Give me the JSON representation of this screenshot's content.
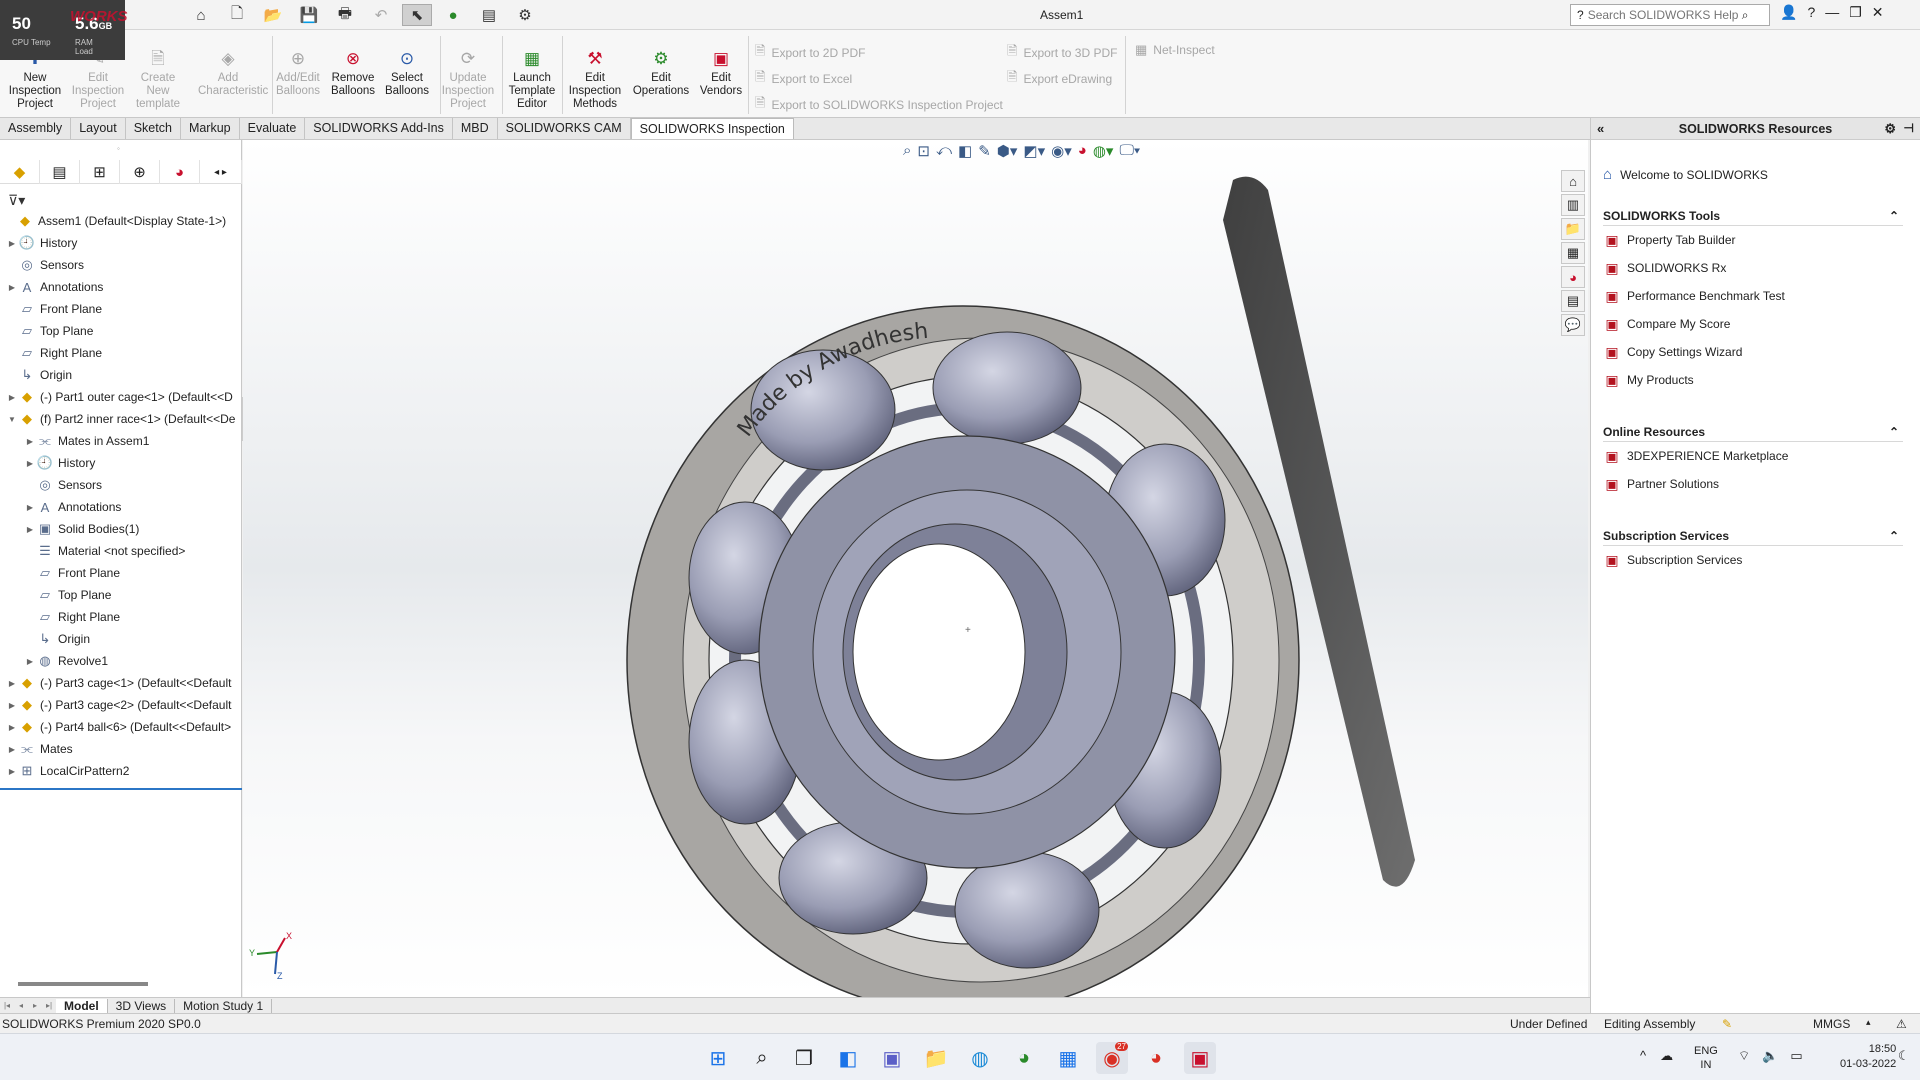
{
  "perf": {
    "cpu_value": "50",
    "cpu_label": "CPU Temp",
    "ram_value": "5.6",
    "ram_unit": "GB",
    "ram_label": "RAM Load"
  },
  "app": {
    "logo": "SOLIDWORKS",
    "doc_title": "Assem1",
    "search_placeholder": "Search SOLIDWORKS Help"
  },
  "commands": [
    {
      "label": "New Inspection Project",
      "icon": "new-inspection-icon",
      "enabled": true
    },
    {
      "label": "Edit Inspection Project",
      "icon": "edit-inspection-icon",
      "enabled": false
    },
    {
      "label": "Create New template",
      "icon": "create-template-icon",
      "enabled": false
    },
    {
      "label": "Add Characteristic",
      "icon": "add-characteristic-icon",
      "enabled": false
    },
    {
      "label": "Add/Edit Balloons",
      "icon": "balloons-icon",
      "enabled": false
    },
    {
      "label": "Remove Balloons",
      "icon": "remove-balloons-icon",
      "enabled": true
    },
    {
      "label": "Select Balloons",
      "icon": "select-balloons-icon",
      "enabled": true
    },
    {
      "label": "Update Inspection Project",
      "icon": "update-project-icon",
      "enabled": false
    },
    {
      "label": "Launch Template Editor",
      "icon": "template-editor-icon",
      "enabled": true
    },
    {
      "label": "Edit Inspection Methods",
      "icon": "methods-icon",
      "enabled": true
    },
    {
      "label": "Edit Operations",
      "icon": "operations-icon",
      "enabled": true
    },
    {
      "label": "Edit Vendors",
      "icon": "vendors-icon",
      "enabled": true
    }
  ],
  "exports": {
    "pdf2d": "Export to 2D PDF",
    "excel": "Export to Excel",
    "inspection": "Export to SOLIDWORKS Inspection Project",
    "pdf3d": "Export to 3D PDF",
    "edrawing": "Export eDrawing",
    "net_inspect": "Net-Inspect"
  },
  "tabs": [
    "Assembly",
    "Layout",
    "Sketch",
    "Markup",
    "Evaluate",
    "SOLIDWORKS Add-Ins",
    "MBD",
    "SOLIDWORKS CAM",
    "SOLIDWORKS Inspection"
  ],
  "active_tab": "SOLIDWORKS Inspection",
  "tree": [
    {
      "label": "Assem1  (Default<Display State-1>)",
      "icon": "assembly-icon",
      "level": 0,
      "exp": ""
    },
    {
      "label": "History",
      "icon": "history-icon",
      "level": 1,
      "exp": "▶"
    },
    {
      "label": "Sensors",
      "icon": "sensors-icon",
      "level": 1,
      "exp": ""
    },
    {
      "label": "Annotations",
      "icon": "annotations-icon",
      "level": 1,
      "exp": "▶"
    },
    {
      "label": "Front Plane",
      "icon": "plane-icon",
      "level": 1,
      "exp": ""
    },
    {
      "label": "Top Plane",
      "icon": "plane-icon",
      "level": 1,
      "exp": ""
    },
    {
      "label": "Right Plane",
      "icon": "plane-icon",
      "level": 1,
      "exp": ""
    },
    {
      "label": "Origin",
      "icon": "origin-icon",
      "level": 1,
      "exp": ""
    },
    {
      "label": "(-) Part1 outer cage<1> (Default<<D",
      "icon": "part-icon",
      "level": 1,
      "exp": "▶"
    },
    {
      "label": "(f) Part2 inner race<1> (Default<<De",
      "icon": "part-icon",
      "level": 1,
      "exp": "▼"
    },
    {
      "label": "Mates in Assem1",
      "icon": "mates-icon",
      "level": 2,
      "exp": "▶"
    },
    {
      "label": "History",
      "icon": "history-icon",
      "level": 2,
      "exp": "▶"
    },
    {
      "label": "Sensors",
      "icon": "sensors-icon",
      "level": 2,
      "exp": ""
    },
    {
      "label": "Annotations",
      "icon": "annotations-icon",
      "level": 2,
      "exp": "▶"
    },
    {
      "label": "Solid Bodies(1)",
      "icon": "solid-bodies-icon",
      "level": 2,
      "exp": "▶"
    },
    {
      "label": "Material <not specified>",
      "icon": "material-icon",
      "level": 2,
      "exp": ""
    },
    {
      "label": "Front Plane",
      "icon": "plane-icon",
      "level": 2,
      "exp": ""
    },
    {
      "label": "Top Plane",
      "icon": "plane-icon",
      "level": 2,
      "exp": ""
    },
    {
      "label": "Right Plane",
      "icon": "plane-icon",
      "level": 2,
      "exp": ""
    },
    {
      "label": "Origin",
      "icon": "origin-icon",
      "level": 2,
      "exp": ""
    },
    {
      "label": "Revolve1",
      "icon": "revolve-icon",
      "level": 2,
      "exp": "▶"
    },
    {
      "label": "(-) Part3 cage<1> (Default<<Default",
      "icon": "part-icon",
      "level": 1,
      "exp": "▶"
    },
    {
      "label": "(-) Part3 cage<2> (Default<<Default",
      "icon": "part-icon",
      "level": 1,
      "exp": "▶"
    },
    {
      "label": "(-) Part4 ball<6> (Default<<Default>",
      "icon": "part-icon",
      "level": 1,
      "exp": "▶"
    },
    {
      "label": "Mates",
      "icon": "mates-icon",
      "level": 1,
      "exp": "▶"
    },
    {
      "label": "LocalCirPattern2",
      "icon": "pattern-icon",
      "level": 1,
      "exp": "▶"
    }
  ],
  "model_tabs": [
    "Model",
    "3D Views",
    "Motion Study 1"
  ],
  "model_text": "Made by Awadhesh",
  "triad": {
    "x": "X",
    "y": "Y",
    "z": "Z"
  },
  "taskpane": {
    "title": "SOLIDWORKS Resources",
    "welcome": "Welcome to SOLIDWORKS",
    "tools_header": "SOLIDWORKS Tools",
    "tools": [
      "Property Tab Builder",
      "SOLIDWORKS Rx",
      "Performance Benchmark Test",
      "Compare My Score",
      "Copy Settings Wizard",
      "My Products"
    ],
    "online_header": "Online Resources",
    "online": [
      "3DEXPERIENCE Marketplace",
      "Partner Solutions"
    ],
    "subs_header": "Subscription Services",
    "subs": [
      "Subscription Services"
    ]
  },
  "status": {
    "left": "SOLIDWORKS Premium 2020 SP0.0",
    "state": "Under Defined",
    "mode": "Editing Assembly",
    "units": "MMGS"
  },
  "taskbar": {
    "lang1": "ENG",
    "lang2": "IN",
    "time": "18:50",
    "date": "01-03-2022",
    "badge": "27"
  }
}
